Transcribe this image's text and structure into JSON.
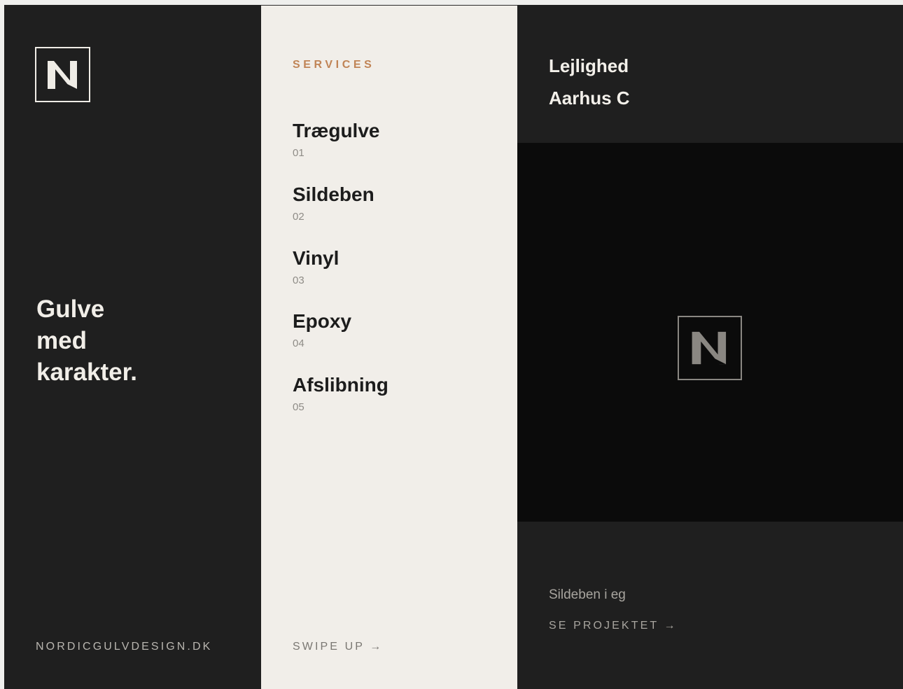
{
  "brand": {
    "logo_letter": "N",
    "colors": {
      "dark": "#1f1f1f",
      "cream": "#f1eee9",
      "accent": "#c08456",
      "black": "#0b0b0b"
    }
  },
  "left": {
    "headline": [
      "Gulve",
      "med",
      "karakter."
    ],
    "site_url": "NORDICGULVDESIGN.DK"
  },
  "services": {
    "label": "SERVICES",
    "items": [
      {
        "name": "Trægulve",
        "number": "01"
      },
      {
        "name": "Sildeben",
        "number": "02"
      },
      {
        "name": "Vinyl",
        "number": "03"
      },
      {
        "name": "Epoxy",
        "number": "04"
      },
      {
        "name": "Afslibning",
        "number": "05"
      }
    ],
    "swipe_label": "SWIPE UP →"
  },
  "project": {
    "title": [
      "Lejlighed",
      "Aarhus C"
    ],
    "image_icon": "logo-placeholder-icon",
    "caption": "Sildeben i eg",
    "link_label": "SE PROJEKTET →"
  }
}
